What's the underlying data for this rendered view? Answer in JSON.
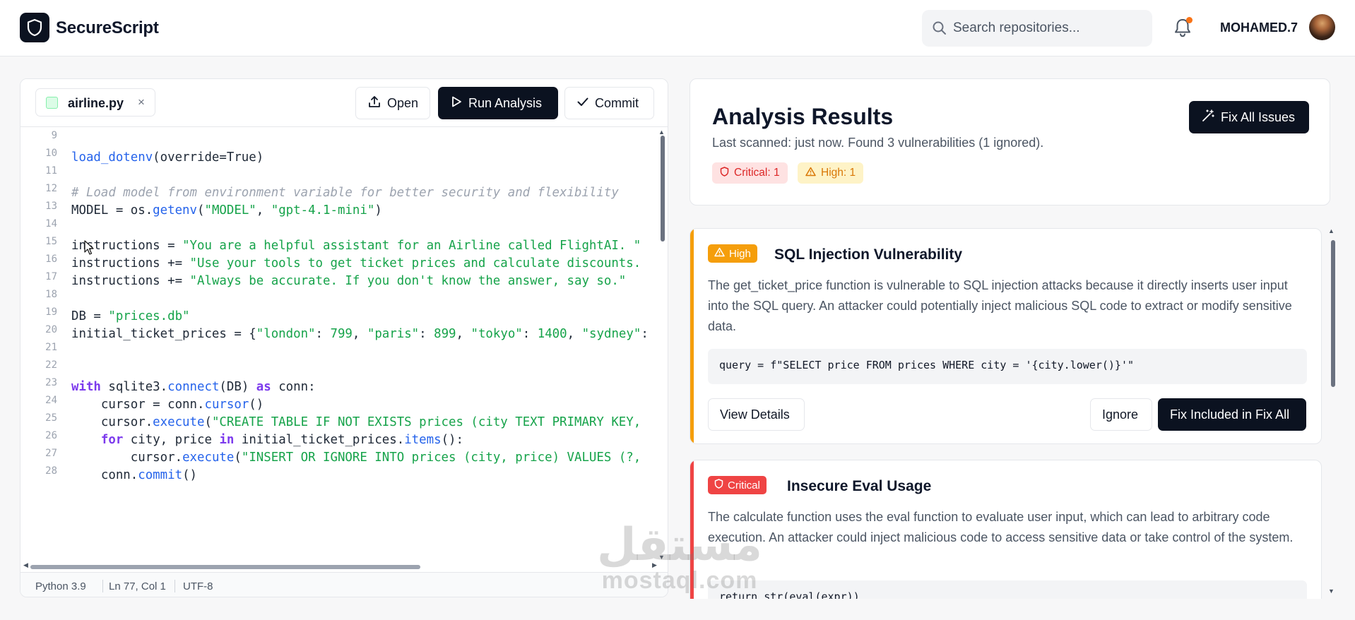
{
  "header": {
    "brand": "SecureScript",
    "search_placeholder": "Search repositories...",
    "username": "MOHAMED.7",
    "notification_dot_color": "#f97316"
  },
  "editor": {
    "file_tab": {
      "name": "airline.py",
      "close": "×"
    },
    "toolbar": {
      "open_label": "Open",
      "run_label": "Run Analysis",
      "commit_label": "Commit"
    },
    "lines": [
      {
        "n": "9",
        "tokens": []
      },
      {
        "n": "10",
        "tokens": [
          {
            "t": "load_dotenv",
            "c": "fn"
          },
          {
            "t": "(override=True)",
            "c": ""
          }
        ]
      },
      {
        "n": "11",
        "tokens": []
      },
      {
        "n": "12",
        "tokens": [
          {
            "t": "# Load model from environment variable for better security and flexibility",
            "c": "cm"
          }
        ]
      },
      {
        "n": "13",
        "tokens": [
          {
            "t": "MODEL = os.",
            "c": ""
          },
          {
            "t": "getenv",
            "c": "fn"
          },
          {
            "t": "(",
            "c": ""
          },
          {
            "t": "\"MODEL\"",
            "c": "str"
          },
          {
            "t": ", ",
            "c": ""
          },
          {
            "t": "\"gpt-4.1-mini\"",
            "c": "str"
          },
          {
            "t": ")",
            "c": ""
          }
        ]
      },
      {
        "n": "14",
        "tokens": []
      },
      {
        "n": "15",
        "tokens": [
          {
            "t": "instructions = ",
            "c": ""
          },
          {
            "t": "\"You are a helpful assistant for an Airline called FlightAI. \"",
            "c": "str"
          }
        ]
      },
      {
        "n": "16",
        "tokens": [
          {
            "t": "instructions += ",
            "c": ""
          },
          {
            "t": "\"Use your tools to get ticket prices and calculate discounts.",
            "c": "str"
          }
        ]
      },
      {
        "n": "17",
        "tokens": [
          {
            "t": "instructions += ",
            "c": ""
          },
          {
            "t": "\"Always be accurate. If you don't know the answer, say so.\"",
            "c": "str"
          }
        ]
      },
      {
        "n": "18",
        "tokens": []
      },
      {
        "n": "19",
        "tokens": [
          {
            "t": "DB = ",
            "c": ""
          },
          {
            "t": "\"prices.db\"",
            "c": "str"
          }
        ]
      },
      {
        "n": "20",
        "tokens": [
          {
            "t": "initial_ticket_prices = {",
            "c": ""
          },
          {
            "t": "\"london\"",
            "c": "str"
          },
          {
            "t": ": ",
            "c": ""
          },
          {
            "t": "799",
            "c": "num"
          },
          {
            "t": ", ",
            "c": ""
          },
          {
            "t": "\"paris\"",
            "c": "str"
          },
          {
            "t": ": ",
            "c": ""
          },
          {
            "t": "899",
            "c": "num"
          },
          {
            "t": ", ",
            "c": ""
          },
          {
            "t": "\"tokyo\"",
            "c": "str"
          },
          {
            "t": ": ",
            "c": ""
          },
          {
            "t": "1400",
            "c": "num"
          },
          {
            "t": ", ",
            "c": ""
          },
          {
            "t": "\"sydney\"",
            "c": "str"
          },
          {
            "t": ":",
            "c": ""
          }
        ]
      },
      {
        "n": "21",
        "tokens": []
      },
      {
        "n": "22",
        "tokens": []
      },
      {
        "n": "23",
        "tokens": [
          {
            "t": "with",
            "c": "kw"
          },
          {
            "t": " sqlite3.",
            "c": ""
          },
          {
            "t": "connect",
            "c": "fn"
          },
          {
            "t": "(DB) ",
            "c": ""
          },
          {
            "t": "as",
            "c": "kw"
          },
          {
            "t": " conn:",
            "c": ""
          }
        ]
      },
      {
        "n": "24",
        "tokens": [
          {
            "t": "    cursor = conn.",
            "c": ""
          },
          {
            "t": "cursor",
            "c": "fn"
          },
          {
            "t": "()",
            "c": ""
          }
        ]
      },
      {
        "n": "25",
        "tokens": [
          {
            "t": "    cursor.",
            "c": ""
          },
          {
            "t": "execute",
            "c": "fn"
          },
          {
            "t": "(",
            "c": ""
          },
          {
            "t": "\"CREATE TABLE IF NOT EXISTS prices (city TEXT PRIMARY KEY,",
            "c": "str"
          }
        ]
      },
      {
        "n": "26",
        "tokens": [
          {
            "t": "    ",
            "c": ""
          },
          {
            "t": "for",
            "c": "kw"
          },
          {
            "t": " city, price ",
            "c": ""
          },
          {
            "t": "in",
            "c": "kw"
          },
          {
            "t": " initial_ticket_prices.",
            "c": ""
          },
          {
            "t": "items",
            "c": "fn"
          },
          {
            "t": "():",
            "c": ""
          }
        ]
      },
      {
        "n": "27",
        "tokens": [
          {
            "t": "        cursor.",
            "c": ""
          },
          {
            "t": "execute",
            "c": "fn"
          },
          {
            "t": "(",
            "c": ""
          },
          {
            "t": "\"INSERT OR IGNORE INTO prices (city, price) VALUES (?,",
            "c": "str"
          }
        ]
      },
      {
        "n": "28",
        "tokens": [
          {
            "t": "    conn.",
            "c": ""
          },
          {
            "t": "commit",
            "c": "fn"
          },
          {
            "t": "()",
            "c": ""
          }
        ]
      }
    ],
    "status": {
      "language": "Python 3.9",
      "position": "Ln 77, Col 1",
      "encoding": "UTF-8"
    }
  },
  "results": {
    "title": "Analysis Results",
    "subtitle": "Last scanned: just now. Found 3 vulnerabilities (1 ignored).",
    "badges": {
      "critical": "Critical: 1",
      "high": "High: 1"
    },
    "fix_all_label": "Fix All Issues",
    "issues": [
      {
        "severity": "High",
        "severity_color": "#f59e0b",
        "title": "SQL Injection Vulnerability",
        "description": "The get_ticket_price function is vulnerable to SQL injection attacks because it directly inserts user input into the SQL query. An attacker could potentially inject malicious SQL code to extract or modify sensitive data.",
        "snippet": "query = f\"SELECT price FROM prices WHERE city = '{city.lower()}'\"",
        "view_label": "View Details",
        "ignore_label": "Ignore",
        "fix_label": "Fix Included in Fix All"
      },
      {
        "severity": "Critical",
        "severity_color": "#ef4444",
        "title": "Insecure Eval Usage",
        "description": "The calculate function uses the eval function to evaluate user input, which can lead to arbitrary code execution. An attacker could inject malicious code to access sensitive data or take control of the system.",
        "snippet": "return str(eval(expr))"
      }
    ]
  },
  "watermark": {
    "arabic": "مستقل",
    "latin": "mostaql.com"
  }
}
